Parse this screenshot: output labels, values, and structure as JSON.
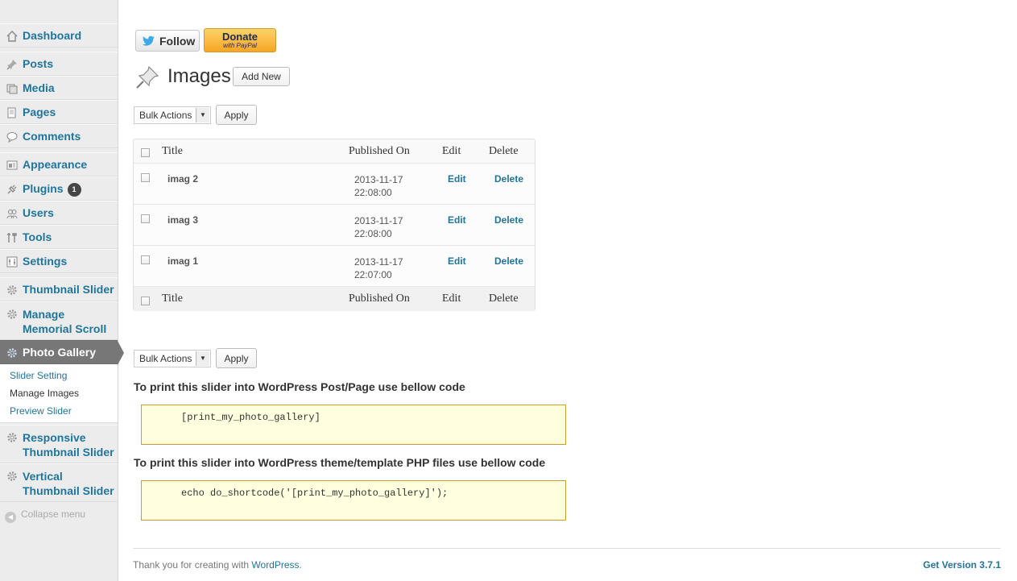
{
  "sidebar": {
    "items": [
      {
        "label": "Dashboard",
        "icon": "home-icon"
      },
      {
        "label": "Posts",
        "icon": "pushpin-icon"
      },
      {
        "label": "Media",
        "icon": "media-icon"
      },
      {
        "label": "Pages",
        "icon": "pages-icon"
      },
      {
        "label": "Comments",
        "icon": "comment-icon"
      },
      {
        "label": "Appearance",
        "icon": "appearance-icon"
      },
      {
        "label": "Plugins",
        "icon": "plug-icon",
        "badge": "1"
      },
      {
        "label": "Users",
        "icon": "users-icon"
      },
      {
        "label": "Tools",
        "icon": "tools-icon"
      },
      {
        "label": "Settings",
        "icon": "settings-icon"
      },
      {
        "label": "Thumbnail Slider",
        "icon": "gear-icon"
      },
      {
        "label_line1": "Manage",
        "label_line2": "Memorial Scroll",
        "icon": "gear-icon"
      },
      {
        "label": "Photo Gallery",
        "icon": "gear-icon",
        "current": true
      },
      {
        "label_line1": "Responsive",
        "label_line2": "Thumbnail Slider",
        "icon": "gear-icon"
      },
      {
        "label_line1": "Vertical",
        "label_line2": "Thumbnail Slider",
        "icon": "gear-icon"
      }
    ],
    "submenu": [
      "Slider Setting",
      "Manage Images",
      "Preview Slider"
    ],
    "collapse": "Collapse menu"
  },
  "header": {
    "follow_label": "Follow",
    "donate_line1": "Donate",
    "donate_line2": "with PayPal",
    "title": "Images",
    "add_new": "Add New"
  },
  "bulk": {
    "select": "Bulk Actions",
    "apply": "Apply"
  },
  "table": {
    "columns": [
      "Title",
      "Published On",
      "Edit",
      "Delete"
    ],
    "rows": [
      {
        "title": "imag 2",
        "date": "2013-11-17",
        "time": "22:08:00",
        "edit": "Edit",
        "delete": "Delete"
      },
      {
        "title": "imag 3",
        "date": "2013-11-17",
        "time": "22:08:00",
        "edit": "Edit",
        "delete": "Delete"
      },
      {
        "title": "imag 1",
        "date": "2013-11-17",
        "time": "22:07:00",
        "edit": "Edit",
        "delete": "Delete"
      }
    ]
  },
  "instructions": {
    "post_heading": "To print this slider into WordPress Post/Page use bellow code",
    "post_code": "[print_my_photo_gallery]",
    "php_heading": "To print this slider into WordPress theme/template PHP files use bellow code",
    "php_code": "echo do_shortcode('[print_my_photo_gallery]');"
  },
  "footer": {
    "thanks_prefix": "Thank you for creating with ",
    "wordpress_link": "WordPress",
    "thanks_suffix": ".",
    "version": "Get Version 3.7.1"
  },
  "colors": {
    "link": "#21759b",
    "current_menu_bg": "#777777",
    "code_bg": "#ffffe0"
  }
}
